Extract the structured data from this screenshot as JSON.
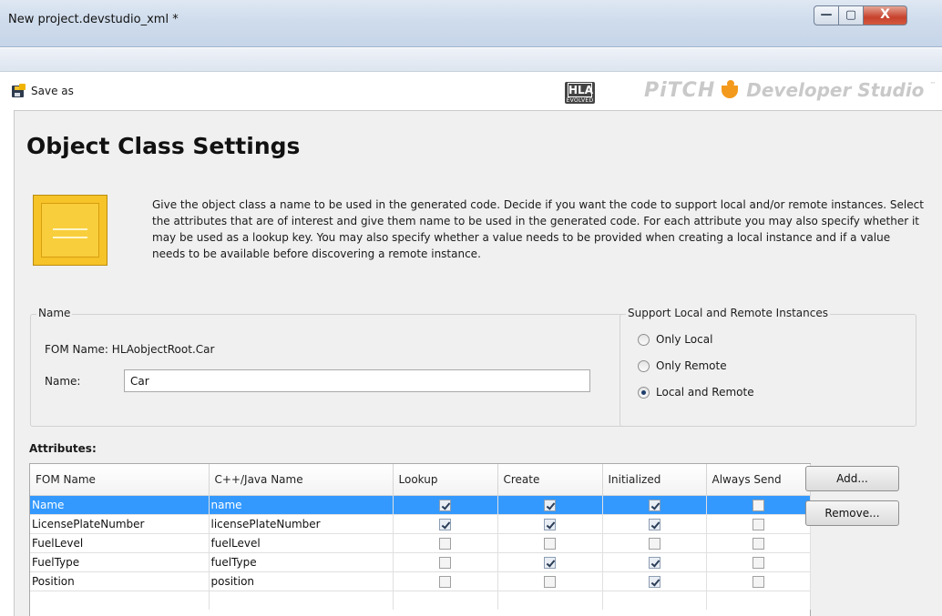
{
  "window": {
    "title": "New project.devstudio_xml *",
    "controls": {
      "minimize": "—",
      "maximize": "▢",
      "close": "X"
    }
  },
  "toolbar": {
    "save_as_label": "Save as",
    "hla_logo": {
      "main": "HLA",
      "sub": "EVOLVED"
    },
    "brand": {
      "company": "PiTCH",
      "product": "Developer Studio",
      "tm": "™"
    }
  },
  "page": {
    "title": "Object Class Settings",
    "description": "Give the object class a name to be used in the generated code. Decide if you want the code to support local and/or remote instances. Select the attributes that are of interest and give them name to be used in the generated code. For each attribute you may also specify whether it may be used as a lookup key. You may also specify whether a value needs to be provided when creating a local instance and if a value needs to be available before discovering a remote instance."
  },
  "name_group": {
    "legend": "Name",
    "fom_name_label": "FOM Name:",
    "fom_name_value": "HLAobjectRoot.Car",
    "name_label": "Name:",
    "name_value": "Car"
  },
  "support_group": {
    "legend": "Support Local and Remote Instances",
    "options": [
      {
        "label": "Only Local",
        "selected": false
      },
      {
        "label": "Only Remote",
        "selected": false
      },
      {
        "label": "Local and Remote",
        "selected": true
      }
    ]
  },
  "attributes": {
    "label": "Attributes:",
    "columns": [
      "FOM Name",
      "C++/Java Name",
      "Lookup",
      "Create",
      "Initialized",
      "Always Send"
    ],
    "rows": [
      {
        "fom": "Name",
        "code": "name",
        "lookup": true,
        "create": true,
        "initialized": true,
        "always_send": false,
        "selected": true
      },
      {
        "fom": "LicensePlateNumber",
        "code": "licensePlateNumber",
        "lookup": true,
        "create": true,
        "initialized": true,
        "always_send": false,
        "selected": false
      },
      {
        "fom": "FuelLevel",
        "code": "fuelLevel",
        "lookup": false,
        "create": false,
        "initialized": false,
        "always_send": false,
        "selected": false
      },
      {
        "fom": "FuelType",
        "code": "fuelType",
        "lookup": false,
        "create": true,
        "initialized": true,
        "always_send": false,
        "selected": false
      },
      {
        "fom": "Position",
        "code": "position",
        "lookup": false,
        "create": false,
        "initialized": true,
        "always_send": false,
        "selected": false
      }
    ],
    "add_button": "Add...",
    "remove_button": "Remove..."
  },
  "colors": {
    "selection": "#3399ff",
    "class_icon": "#f6c328",
    "brand_sun": "#f39a1c"
  },
  "icons": [
    "save-icon",
    "hla-logo",
    "pitch-logo",
    "object-class-icon",
    "checkbox",
    "radio"
  ]
}
